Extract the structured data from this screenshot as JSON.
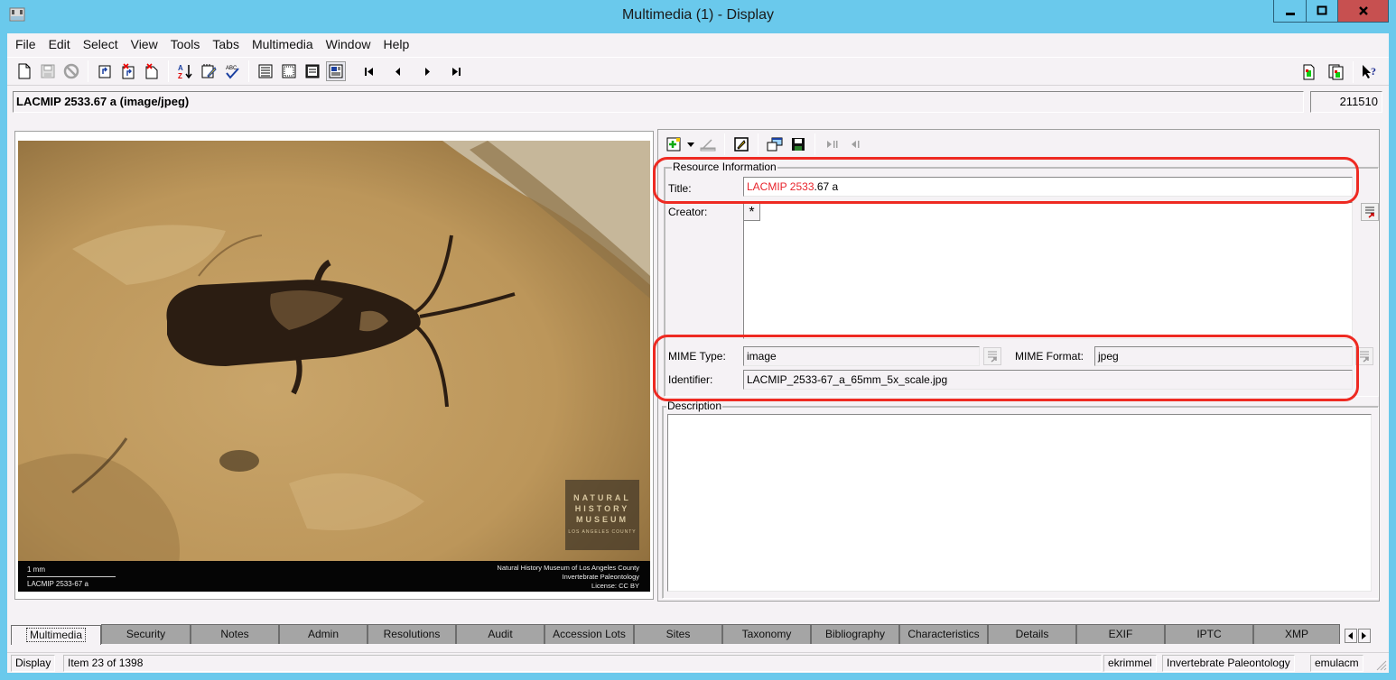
{
  "window": {
    "title": "Multimedia (1) - Display",
    "controls": [
      "minimize",
      "maximize",
      "close"
    ]
  },
  "menu": [
    "File",
    "Edit",
    "Select",
    "View",
    "Tools",
    "Tabs",
    "Multimedia",
    "Window",
    "Help"
  ],
  "toolbar": {
    "groups": [
      [
        "new-record-icon",
        "save-icon",
        "cancel-icon"
      ],
      [
        "copy-record-icon",
        "delete-record-icon",
        "discard-record-icon"
      ],
      [
        "sort-icon",
        "notes-icon",
        "spellcheck-icon"
      ],
      [
        "list-view-icon",
        "grid-view-icon",
        "details-view-icon",
        "page-view-icon"
      ],
      [
        "first-record-icon",
        "previous-record-icon",
        "next-record-icon",
        "last-record-icon"
      ]
    ],
    "right": [
      "attach-icon",
      "attach-multiple-icon",
      "context-help-icon"
    ]
  },
  "record": {
    "summary": "LACMIP 2533.67 a (image/jpeg)",
    "irn": "211510"
  },
  "image": {
    "scale_label": "1 mm",
    "specimen_label": "LACMIP 2533-67 a",
    "credit_lines": [
      "Natural History Museum of Los Angeles County",
      "Invertebrate Paleontology",
      "License: CC BY"
    ],
    "logo_lines": [
      "NATURAL",
      "HISTORY",
      "MUSEUM"
    ],
    "logo_subline": "LOS ANGELES COUNTY"
  },
  "detail_toolbar": [
    "add-multimedia-icon",
    "dropdown-arrow-icon",
    "scanner-icon",
    "edit-icon",
    "open-viewer-icon",
    "save-disk-icon",
    "play-icon",
    "rewind-icon"
  ],
  "resource_info": {
    "legend": "Resource Information",
    "title_label": "Title:",
    "title_red_part": "LACMIP 2533",
    "title_rest": ".67 a",
    "creator_label": "Creator:",
    "creator_marker": "*",
    "mime_type_label": "MIME Type:",
    "mime_type_value": "image",
    "mime_format_label": "MIME Format:",
    "mime_format_value": "jpeg",
    "identifier_label": "Identifier:",
    "identifier_value": "LACMIP_2533-67_a_65mm_5x_scale.jpg"
  },
  "description": {
    "legend": "Description",
    "value": ""
  },
  "tabs": {
    "active": "Multimedia",
    "items": [
      "Multimedia",
      "Security",
      "Notes",
      "Admin",
      "Resolutions",
      "Audit",
      "Accession Lots",
      "Sites",
      "Taxonomy",
      "Bibliography",
      "Characteristics",
      "Details",
      "EXIF",
      "IPTC",
      "XMP"
    ]
  },
  "status": {
    "mode": "Display",
    "position": "Item 23 of 1398",
    "user": "ekrimmel",
    "department": "Invertebrate Paleontology",
    "database": "emulacm"
  },
  "colors": {
    "titlebar": "#6ac9ec",
    "close_button": "#c75050",
    "annotation": "#ee2a22",
    "title_highlight": "#e8242c"
  }
}
